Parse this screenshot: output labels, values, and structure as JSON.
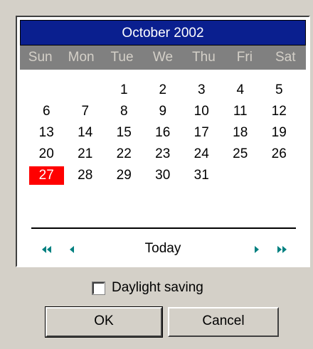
{
  "calendar": {
    "month_title": "October 2002",
    "weekdays": [
      "Sun",
      "Mon",
      "Tue",
      "We",
      "Thu",
      "Fri",
      "Sat"
    ],
    "weeks": [
      [
        "",
        "",
        "1",
        "2",
        "3",
        "4",
        "5"
      ],
      [
        "6",
        "7",
        "8",
        "9",
        "10",
        "11",
        "12"
      ],
      [
        "13",
        "14",
        "15",
        "16",
        "17",
        "18",
        "19"
      ],
      [
        "20",
        "21",
        "22",
        "23",
        "24",
        "25",
        "26"
      ],
      [
        "27",
        "28",
        "29",
        "30",
        "31",
        "",
        ""
      ]
    ],
    "selected_day": "27",
    "today_label": "Today",
    "nav_icons": [
      "double-left-arrow-icon",
      "left-arrow-icon",
      "right-arrow-icon",
      "double-right-arrow-icon"
    ]
  },
  "daylight_saving": {
    "label": "Daylight saving",
    "checked": false
  },
  "buttons": {
    "ok_label": "OK",
    "cancel_label": "Cancel"
  },
  "colors": {
    "header_bg": "#0a1f8f",
    "weekday_bg": "#808080",
    "selected_bg": "#ff0000",
    "nav_arrow": "#008080",
    "dialog_bg": "#d4d0c8"
  }
}
